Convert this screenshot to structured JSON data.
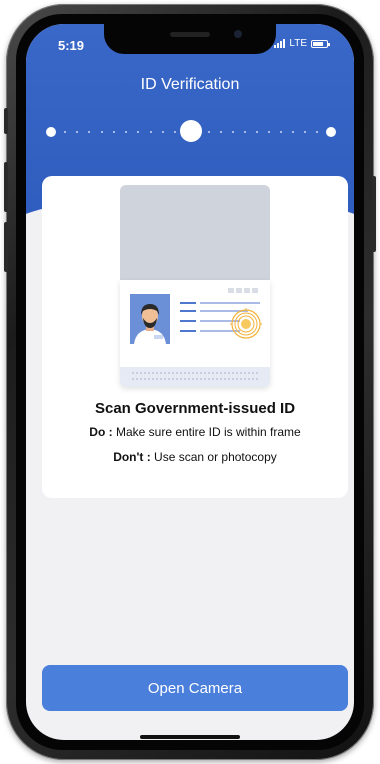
{
  "status_bar": {
    "time": "5:19",
    "network": "LTE"
  },
  "header": {
    "title": "ID Verification"
  },
  "progress": {
    "current_step": 2,
    "total_steps": 3
  },
  "card": {
    "heading": "Scan Government-issued ID",
    "do_label": "Do :",
    "do_text": "Make sure entire ID is within frame",
    "dont_label": "Don't :",
    "dont_text": "Use scan or photocopy"
  },
  "actions": {
    "open_camera_label": "Open Camera"
  },
  "colors": {
    "header_blue": "#3a68c8",
    "button_blue": "#4a7fdb",
    "seal_gold": "#f2b23a"
  }
}
